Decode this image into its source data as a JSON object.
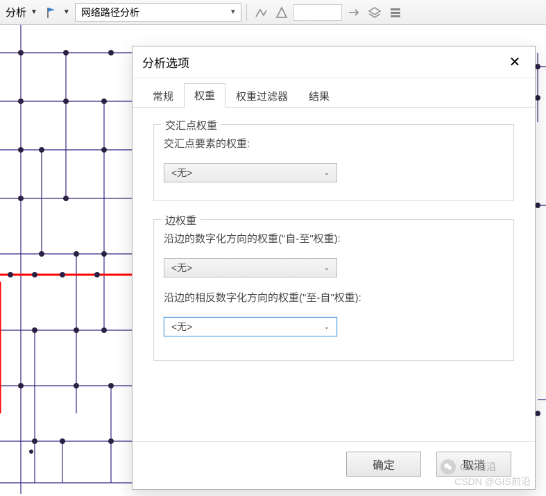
{
  "toolbar": {
    "analyze_label": "分析",
    "combo_main": "网络路径分析",
    "icon_flag": "flag-icon",
    "icon_trace": "trace-icon",
    "icon_direction": "direction-icon",
    "icon_layers": "layers-icon",
    "icon_options": "options-icon"
  },
  "dialog": {
    "title": "分析选项",
    "tabs": {
      "general": "常规",
      "weight": "权重",
      "weight_filter": "权重过滤器",
      "result": "结果"
    },
    "group_junction": {
      "title": "交汇点权重",
      "label": "交汇点要素的权重:",
      "combo_value": "<无>"
    },
    "group_edge": {
      "title": "边权重",
      "label_from_to": "沿边的数字化方向的权重(\"自-至\"权重):",
      "combo_from_to_value": "<无>",
      "label_to_from": "沿边的相反数字化方向的权重(\"至-自\"权重):",
      "combo_to_from_value": "<无>"
    },
    "buttons": {
      "ok": "确定",
      "cancel": "取消"
    }
  },
  "watermark": {
    "wechat": "GIS前沿",
    "csdn": "CSDN @GIS前沿"
  }
}
